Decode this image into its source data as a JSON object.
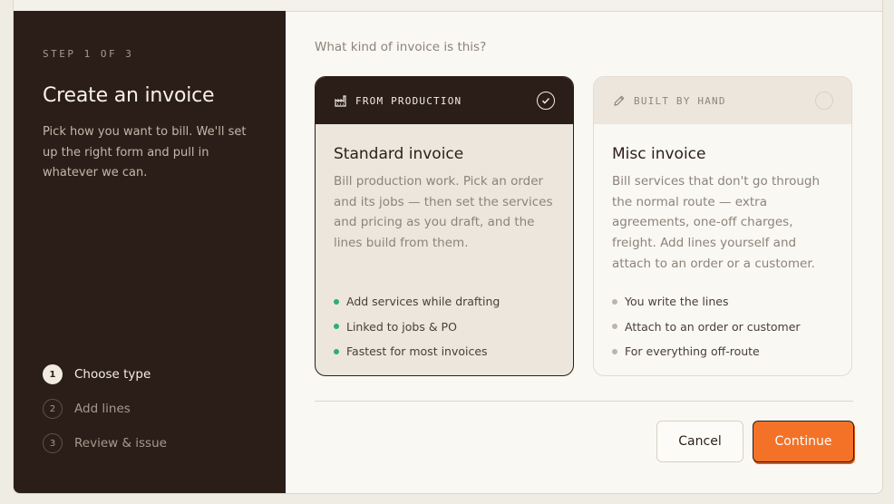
{
  "sidebar": {
    "step_label": "STEP 1 OF 3",
    "title": "Create an invoice",
    "description": "Pick how you want to bill. We'll set up the right form and pull in whatever we can.",
    "steps": [
      {
        "num": "1",
        "label": "Choose type",
        "active": true
      },
      {
        "num": "2",
        "label": "Add lines",
        "active": false
      },
      {
        "num": "3",
        "label": "Review & issue",
        "active": false
      }
    ]
  },
  "main": {
    "question": "What kind of invoice is this?",
    "cards": {
      "standard": {
        "tag": "FROM PRODUCTION",
        "icon": "factory-icon",
        "selected": true,
        "title": "Standard invoice",
        "description": "Bill production work. Pick an order and its jobs — then set the services and pricing as you draft, and the lines build from them.",
        "bullets": [
          "Add services while drafting",
          "Linked to jobs & PO",
          "Fastest for most invoices"
        ]
      },
      "misc": {
        "tag": "BUILT BY HAND",
        "icon": "pencil-icon",
        "selected": false,
        "title": "Misc invoice",
        "description": "Bill services that don't go through the normal route — extra agreements, one-off charges, freight. Add lines yourself and attach to an order or a customer.",
        "bullets": [
          "You write the lines",
          "Attach to an order or customer",
          "For everything off-route"
        ]
      }
    },
    "buttons": {
      "cancel": "Cancel",
      "continue": "Continue"
    }
  },
  "colors": {
    "accent": "#f37227",
    "sidebar_bg": "#2b1e18",
    "bullet_green": "#2fae6f"
  }
}
